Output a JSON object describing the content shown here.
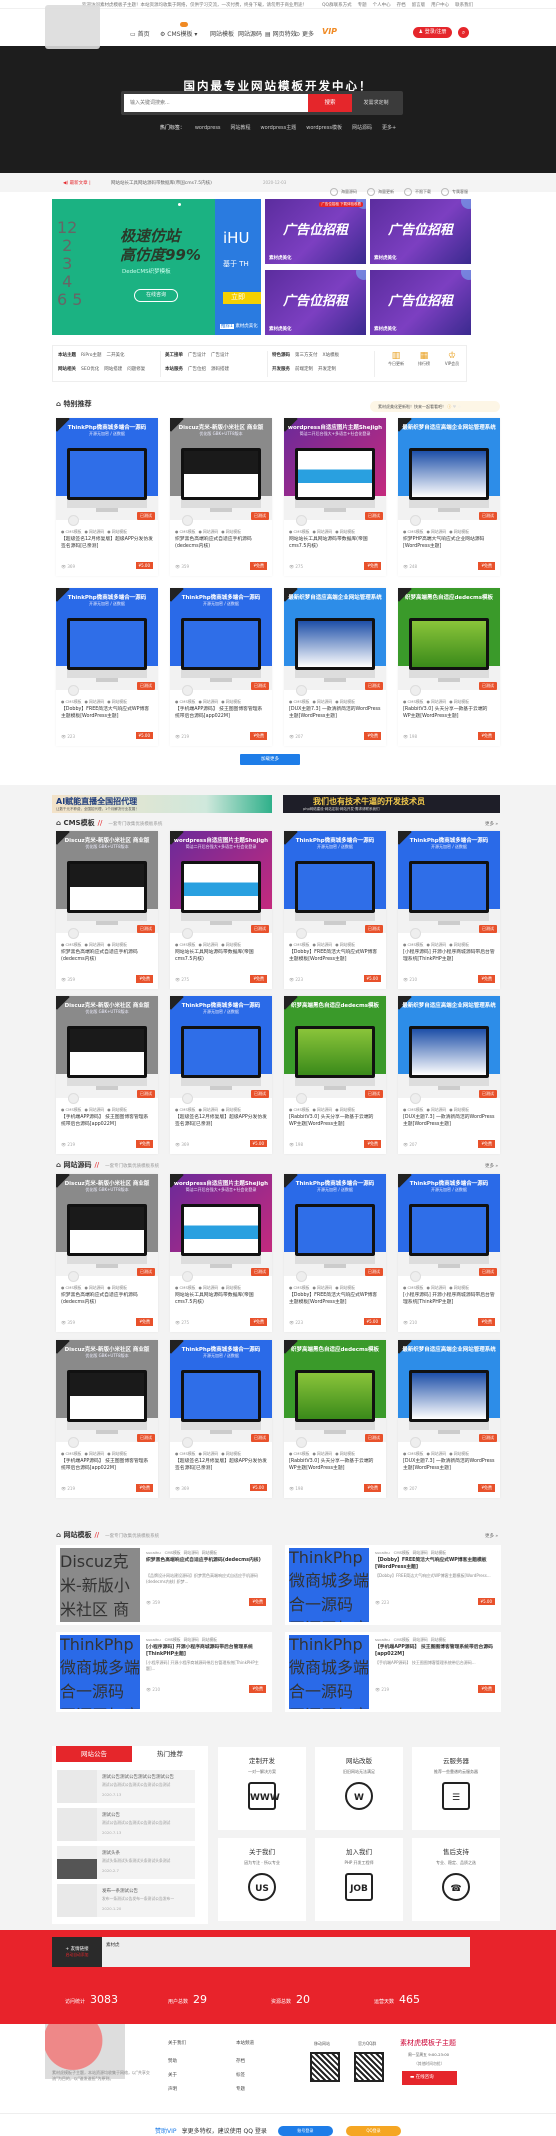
{
  "colors": {
    "accent": "#e5262b",
    "hero_bg": "#1d1d1d",
    "load_more": "#1e7de8"
  },
  "topbar": {
    "notice": "欢迎访问素材虎模板子主题！本站资源均收集于网络，仅供学习交流，一次付费，终身下载，请勿用于商业用途！",
    "links": [
      "QQ群联系方式",
      "专题",
      "个人中心",
      "存档",
      "留言版",
      "用户中心",
      "联系我们"
    ]
  },
  "nav": {
    "items": [
      {
        "icon": "monitor-icon",
        "label": "首页"
      },
      {
        "icon": "cms-icon",
        "label": "CMS模板",
        "badge": "hot"
      },
      {
        "label": "网站模板"
      },
      {
        "label": "网站源码"
      },
      {
        "icon": "page-icon",
        "label": "网页特效"
      },
      {
        "icon": "more-icon",
        "label": "更多"
      }
    ],
    "vip": "VIP",
    "login": "登录/注册"
  },
  "hero": {
    "title": "国内最专业网站模板开发中心！",
    "search_placeholder": "输入关键词搜索...",
    "search_button": "搜索",
    "custom_button": "发需求定制",
    "hot_label": "热门标签：",
    "hot_tags": [
      "wordpress",
      "网站教程",
      "wordpress主题",
      "wordpress模板",
      "网站源码",
      "更多+"
    ]
  },
  "ticker": {
    "label": "最新文章",
    "text": "网站站长工具网站源码带数据库(帝国cms7.5内核)",
    "date": "2020-12-03",
    "features": [
      "海量源码",
      "海量更新",
      "不限下载",
      "专属客服"
    ]
  },
  "slider": {
    "headline1": "极速仿站",
    "headline2": "高仿度99%",
    "sub": "DedeCMS织梦模板",
    "button": "在线咨询",
    "next_title": "iHU",
    "next_sub": "基于 TH",
    "next_button": "立即",
    "tag": "推荐1",
    "tag_text": "素材虎美化"
  },
  "ads": [
    {
      "title": "广告位招租",
      "brand": "素材虎美化",
      "label": "广告位招租 下载体验收看"
    },
    {
      "title": "广告位招租",
      "brand": "素材虎美化"
    },
    {
      "title": "广告位招租",
      "brand": "素材虎美化"
    },
    {
      "title": "广告位招租",
      "brand": "素材虎美化"
    }
  ],
  "quick": {
    "groups": [
      {
        "rows": [
          {
            "head": "本站主题",
            "items": [
              "RiPro主题",
              "二开美化"
            ]
          },
          {
            "head": "网站相关",
            "items": [
              "SEO优化",
              "网站搭建",
              "问题修复"
            ]
          }
        ]
      },
      {
        "rows": [
          {
            "head": "美工接单",
            "items": [
              "广告设计",
              "广告设计"
            ]
          },
          {
            "head": "本站服务",
            "items": [
              "广告位招",
              "源码搭建"
            ]
          }
        ]
      },
      {
        "rows": [
          {
            "head": "特色源码",
            "items": [
              "第三方支付",
              "X站模板"
            ]
          },
          {
            "head": "开发服务",
            "items": [
              "前端定制",
              "开发定制"
            ]
          }
        ]
      }
    ],
    "icons": [
      {
        "icon": "chart-icon",
        "label": "今日更新"
      },
      {
        "icon": "calendar-icon",
        "label": "排行榜"
      },
      {
        "icon": "crown-icon",
        "label": "VIP会员"
      }
    ]
  },
  "featured": {
    "title": "特别推荐",
    "notice": "素材虎美化更新啦！快来一起看看吧！",
    "load_more": "加载更多"
  },
  "ai_banner": {
    "left": "AI赋能直播全国招代理",
    "left_sub": "让数千元不菲费，全国招代理，1个月解决行业发展！",
    "right": "我们也有技术牛逼的开发技术员",
    "right_sub": "php网络建设·网站定制·网站开发·需求请联系我们"
  },
  "sections": {
    "cms": {
      "title": "CMS模板",
      "sub": "一套专门收集优质模板系统",
      "more": "更多 »"
    },
    "source": {
      "title": "网站源码",
      "sub": "一套专门收集优质模板系统",
      "more": "更多 »"
    },
    "templates": {
      "title": "网站模板",
      "sub": "一套专门收集优质模板系统",
      "more": "更多 »"
    }
  },
  "card_types": {
    "tp": {
      "head": "ThinkPhp微商城多端合一源码",
      "sub": "开源无加密 / 送数据",
      "bg": "#2a6ae8"
    },
    "dz": {
      "head": "Discuz克米-新版小米社区 商业版",
      "sub": "优化版 GBK+UTF8版本",
      "bg": "#8a8a8a"
    },
    "wp": {
      "head": "wordpress自适应图片主题Shejigh",
      "sub": "简洁二开后台强大+多语言+社会化登录",
      "bg": "#6a2a9a"
    },
    "dede": {
      "head": "最新织梦自适应高端企业网站管理系统",
      "sub": "",
      "bg": "#2d8de8"
    },
    "green": {
      "head": "织梦高端黑色自适应dedecms模板",
      "sub": "",
      "bg": "#3a9a2a"
    }
  },
  "cards": {
    "featured": [
      {
        "type": "tp",
        "title": "【超级签名12月修复版】超级APP分发仿发签名源码[已亲测]",
        "badge": "已测试",
        "views": "369",
        "price": "¥5.00"
      },
      {
        "type": "dz",
        "title": "织梦黑色高端响应式自适应手机源码(dedecms内核)",
        "badge": "已测试",
        "views": "359",
        "price": "¥免费"
      },
      {
        "type": "wp",
        "title": "网站站长工具网站源码带数据库(帝国cms7.5内核)",
        "badge": "已测试",
        "views": "275",
        "price": "¥免费"
      },
      {
        "type": "dede",
        "title": "织梦PHP高端大气响应式企业网站源码[WordPress主题]",
        "badge": "已测试",
        "views": "248",
        "price": "¥免费"
      },
      {
        "type": "tp",
        "title": "【Dobby】FREE简洁大气响应式WP博客主题模板[WordPress主题]",
        "badge": "已测试",
        "views": "223",
        "price": "¥5.00"
      },
      {
        "type": "tp",
        "title": "【手机端APP源码】 技王图图博客管理系统带后台源码[app022M]",
        "badge": "已测试",
        "views": "219",
        "price": "¥免费"
      },
      {
        "type": "dede",
        "title": "[DUX主题7.3] 一款清新简洁的WordPress主题[WordPress主题]",
        "badge": "已测试",
        "views": "207",
        "price": "¥免费"
      },
      {
        "type": "green",
        "title": "[RabbitV3.0] 头天分享一款基于云端的WP主题[WordPress主题]",
        "badge": "已测试",
        "views": "198",
        "price": "¥免费"
      }
    ],
    "cms": [
      {
        "type": "dz",
        "title": "织梦黑色高端响应式自适应手机源码(dedecms内核)",
        "badge": "已测试",
        "views": "359",
        "price": "¥免费"
      },
      {
        "type": "wp",
        "title": "网站站长工具网站源码带数据库(帝国cms7.5内核)",
        "badge": "已测试",
        "views": "275",
        "price": "¥免费"
      },
      {
        "type": "tp",
        "title": "【Dobby】FREE简洁大气响应式WP博客主题模板[WordPress主题]",
        "badge": "已测试",
        "views": "223",
        "price": "¥5.00"
      },
      {
        "type": "tp",
        "title": "[小程序源码] 开源小程序商城源码带后台管理系统[ThinkPHP主题]",
        "badge": "已测试",
        "views": "210",
        "price": "¥免费"
      },
      {
        "type": "dz",
        "title": "【手机端APP源码】 技王图图博客管理系统带后台源码[app022M]",
        "badge": "已测试",
        "views": "219",
        "price": "¥免费"
      },
      {
        "type": "tp",
        "title": "【超级签名12月修复版】超级APP分发仿发签名源码[已亲测]",
        "badge": "已测试",
        "views": "369",
        "price": "¥5.00"
      },
      {
        "type": "green",
        "title": "[RabbitV3.0] 头天分享一款基于云端的WP主题[WordPress主题]",
        "badge": "已测试",
        "views": "198",
        "price": "¥免费"
      },
      {
        "type": "dede",
        "title": "[DUX主题7.3] 一款清新简洁的WordPress主题[WordPress主题]",
        "badge": "已测试",
        "views": "207",
        "price": "¥免费"
      }
    ],
    "source": [
      {
        "type": "dz",
        "title": "织梦黑色高端响应式自适应手机源码(dedecms内核)",
        "badge": "已测试",
        "views": "359",
        "price": "¥免费"
      },
      {
        "type": "wp",
        "title": "网站站长工具网站源码带数据库(帝国cms7.5内核)",
        "badge": "已测试",
        "views": "275",
        "price": "¥免费"
      },
      {
        "type": "tp",
        "title": "【Dobby】FREE简洁大气响应式WP博客主题模板[WordPress主题]",
        "badge": "已测试",
        "views": "223",
        "price": "¥5.00"
      },
      {
        "type": "tp",
        "title": "[小程序源码] 开源小程序商城源码带后台管理系统[ThinkPHP主题]",
        "badge": "已测试",
        "views": "210",
        "price": "¥免费"
      },
      {
        "type": "dz",
        "title": "【手机端APP源码】 技王图图博客管理系统带后台源码[app022M]",
        "badge": "已测试",
        "views": "219",
        "price": "¥免费"
      },
      {
        "type": "tp",
        "title": "【超级签名12月修复版】超级APP分发仿发签名源码[已亲测]",
        "badge": "已测试",
        "views": "369",
        "price": "¥5.00"
      },
      {
        "type": "green",
        "title": "[RabbitV3.0] 头天分享一款基于云端的WP主题[WordPress主题]",
        "badge": "已测试",
        "views": "198",
        "price": "¥免费"
      },
      {
        "type": "dede",
        "title": "[DUX主题7.3] 一款清新简洁的WordPress主题[WordPress主题]",
        "badge": "已测试",
        "views": "207",
        "price": "¥免费"
      }
    ],
    "templates": [
      {
        "type": "dz",
        "author": "sucaihu",
        "title": "织梦黑色高端响应式自适应手机源码(dedecms内核)",
        "desc": "【品牌设计网站建设源码】织梦黑色高端响应式自适应手机源码(dedecms内核) 织梦...",
        "views": "359",
        "price": "¥免费"
      },
      {
        "type": "tp",
        "author": "sucaihu",
        "title": "【Dobby】FREE简洁大气响应式WP博客主题模板[WordPress主题]",
        "desc": "【Dobby】FREE简洁大气响应式WP博客主题模板[WordPress...",
        "views": "223",
        "price": "¥5.00"
      },
      {
        "type": "tp",
        "author": "sucaihu",
        "title": "[小程序源码] 开源小程序商城源码带后台管理系统[ThinkPHP主题]",
        "desc": "[小程序源码] 开源小程序商城源码带后台管理系统[ThinkPHP主题]...",
        "views": "210",
        "price": "¥免费"
      },
      {
        "type": "tp",
        "author": "sucaihu",
        "title": "【手机端APP源码】 技王图图博客管理系统带后台源码[app022M]",
        "desc": "【手机端APP源码】 技王图图博客管理系统带后台源码...",
        "views": "219",
        "price": "¥免费"
      }
    ]
  },
  "card_tags": [
    "CMS模板",
    "网站源码",
    "网站模板"
  ],
  "notices": {
    "tabs": [
      "网站公告",
      "热门推荐"
    ],
    "items": [
      {
        "title": "测试公告测试公告测试公告测试公告",
        "desc": "测试公告测试公告测试公告测试公告测试",
        "date": "2020.7.13"
      },
      {
        "title": "测试公告",
        "desc": "测试公告测试公告测试公告测试公告测试",
        "date": "2020.7.13"
      },
      {
        "title": "测试头条",
        "desc": "测试头条测试头条测试头条测试头条测试",
        "date": "2020.2.7"
      },
      {
        "title": "发布一条测试公告",
        "desc": "发布一条测试公告发布一条测试公告发布一",
        "date": "2020.1.20"
      }
    ]
  },
  "services": [
    {
      "title": "定制开发",
      "desc": "一对一解决方案",
      "icon": "www-icon",
      "glyph": "WWW"
    },
    {
      "title": "网站改版",
      "desc": "旧旧网站无法满足",
      "icon": "wordpress-icon",
      "glyph": "W"
    },
    {
      "title": "云服务器",
      "desc": "推荐一些靠谱的云服务器",
      "icon": "server-icon",
      "glyph": "☰"
    },
    {
      "title": "关于我们",
      "desc": "因为专注 · 所以专业",
      "icon": "contact-us-icon",
      "glyph": "US"
    },
    {
      "title": "加入我们",
      "desc": "PHP 开发工程师",
      "icon": "job-icon",
      "glyph": "JOB"
    },
    {
      "title": "售后支持",
      "desc": "专业、稳定、品质之选",
      "icon": "headset-icon",
      "glyph": "☎"
    }
  ],
  "friend_links": {
    "label": "+ 友情链接",
    "sub": "启动自动添加",
    "items": [
      "素材虎"
    ]
  },
  "stats": [
    {
      "label": "访问统计",
      "value": "3083"
    },
    {
      "label": "用户总数",
      "value": "29"
    },
    {
      "label": "资源总数",
      "value": "20"
    },
    {
      "label": "运营天数",
      "value": "465"
    }
  ],
  "footer": {
    "about": "素材虎模板子主题，本站资源均收集于网络，以\"共享交流\"为目的，以\"谁发谁担\"为原则。",
    "col1": {
      "title": "关于我们",
      "items": [
        "赞助",
        "关于",
        "声明"
      ]
    },
    "col2": {
      "title": "本站频道",
      "items": [
        "存档",
        "标签",
        "专题"
      ]
    },
    "qr1": "移动网站",
    "qr2": "官方QQ群",
    "brand": "素材虎模板子主题",
    "hours": "周一至周五 9:00-23:00",
    "hours_note": "（其他时间勿扰）",
    "consult": "在线咨询"
  },
  "bottombar": {
    "vip": "赞助VIP",
    "text": "享更多特权，建议使用 QQ 登录",
    "btn1": "账号登录",
    "btn2": "QQ登录"
  }
}
